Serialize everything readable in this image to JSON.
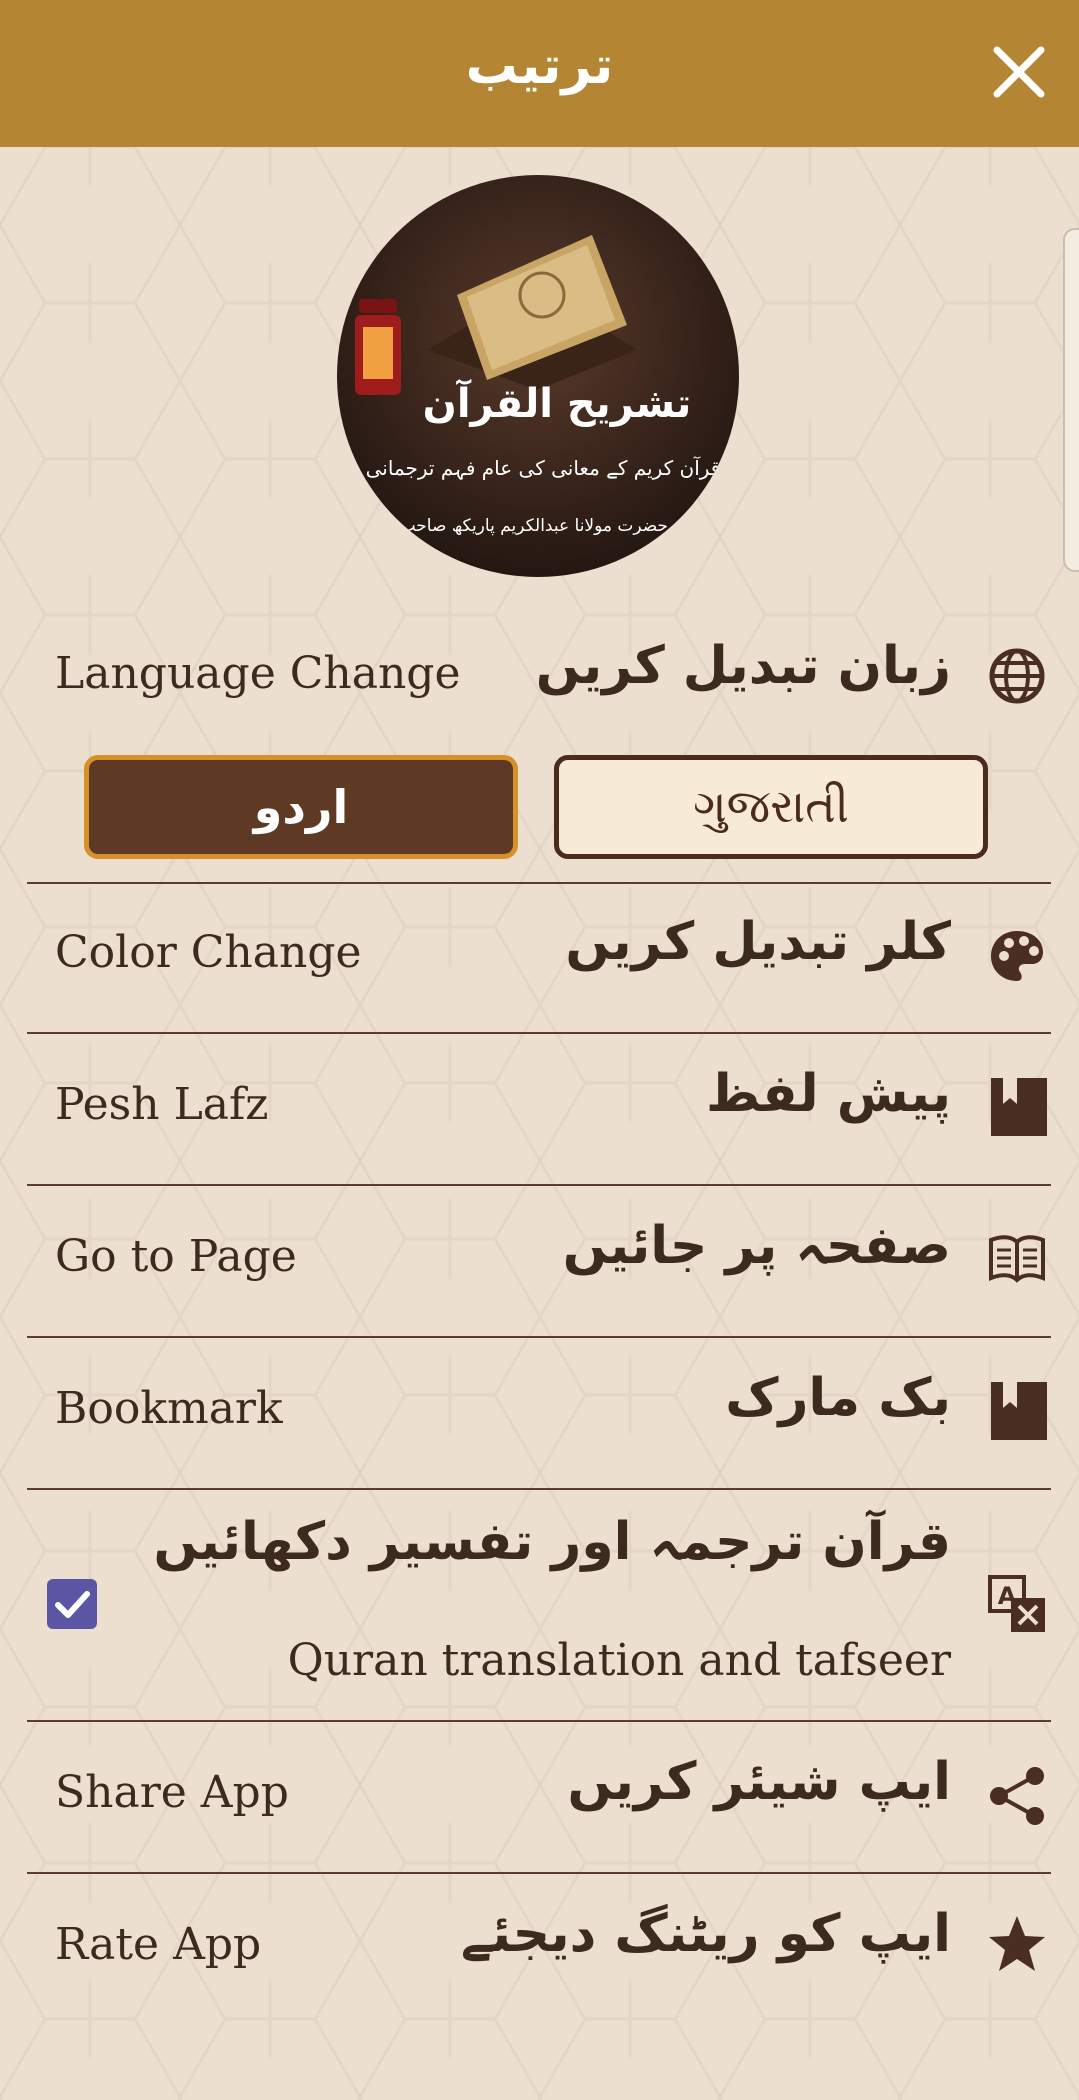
{
  "header": {
    "title": "ترتیب",
    "close_icon": "close-icon"
  },
  "logo": {
    "title": "تشریح القرآن",
    "subtitle": "قرآن کریم کے معانی کی عام فہم ترجمانی",
    "author": "از حضرت مولانا عبدالکریم پاریکھ صاحب"
  },
  "language": {
    "label_en": "Language Change",
    "label_ur": "زبان تبدیل کریں",
    "icon": "globe-icon",
    "options": {
      "urdu": "اردو",
      "gujarati": "ગુજરાતી"
    },
    "selected": "urdu"
  },
  "menu": {
    "color": {
      "en": "Color Change",
      "ur": "کلر تبدیل کریں",
      "icon": "palette-icon"
    },
    "pesh": {
      "en": "Pesh Lafz",
      "ur": "پیش لفظ",
      "icon": "bookmark-icon"
    },
    "goto": {
      "en": "Go to Page",
      "ur": "صفحہ پر جائیں",
      "icon": "open-book-icon"
    },
    "bookmark": {
      "en": "Bookmark",
      "ur": "بک مارک",
      "icon": "bookmark-icon"
    },
    "translation": {
      "ur": "قرآن ترجمہ اور تفسیر دکھائیں",
      "en": "Quran translation and tafseer",
      "icon": "translate-icon",
      "checked": true
    },
    "share": {
      "en": "Share App",
      "ur": "ایپ شیئر کریں",
      "icon": "share-icon"
    },
    "rate": {
      "en": "Rate App",
      "ur": "ایپ کو ریٹنگ دیجئے",
      "icon": "star-icon"
    }
  },
  "colors": {
    "header": "#b48634",
    "background": "#ecdfcf",
    "text": "#3d2a1f",
    "urdu_button": "#5e3a25",
    "urdu_button_border": "#d6912b",
    "checkbox": "#5b55a3"
  }
}
